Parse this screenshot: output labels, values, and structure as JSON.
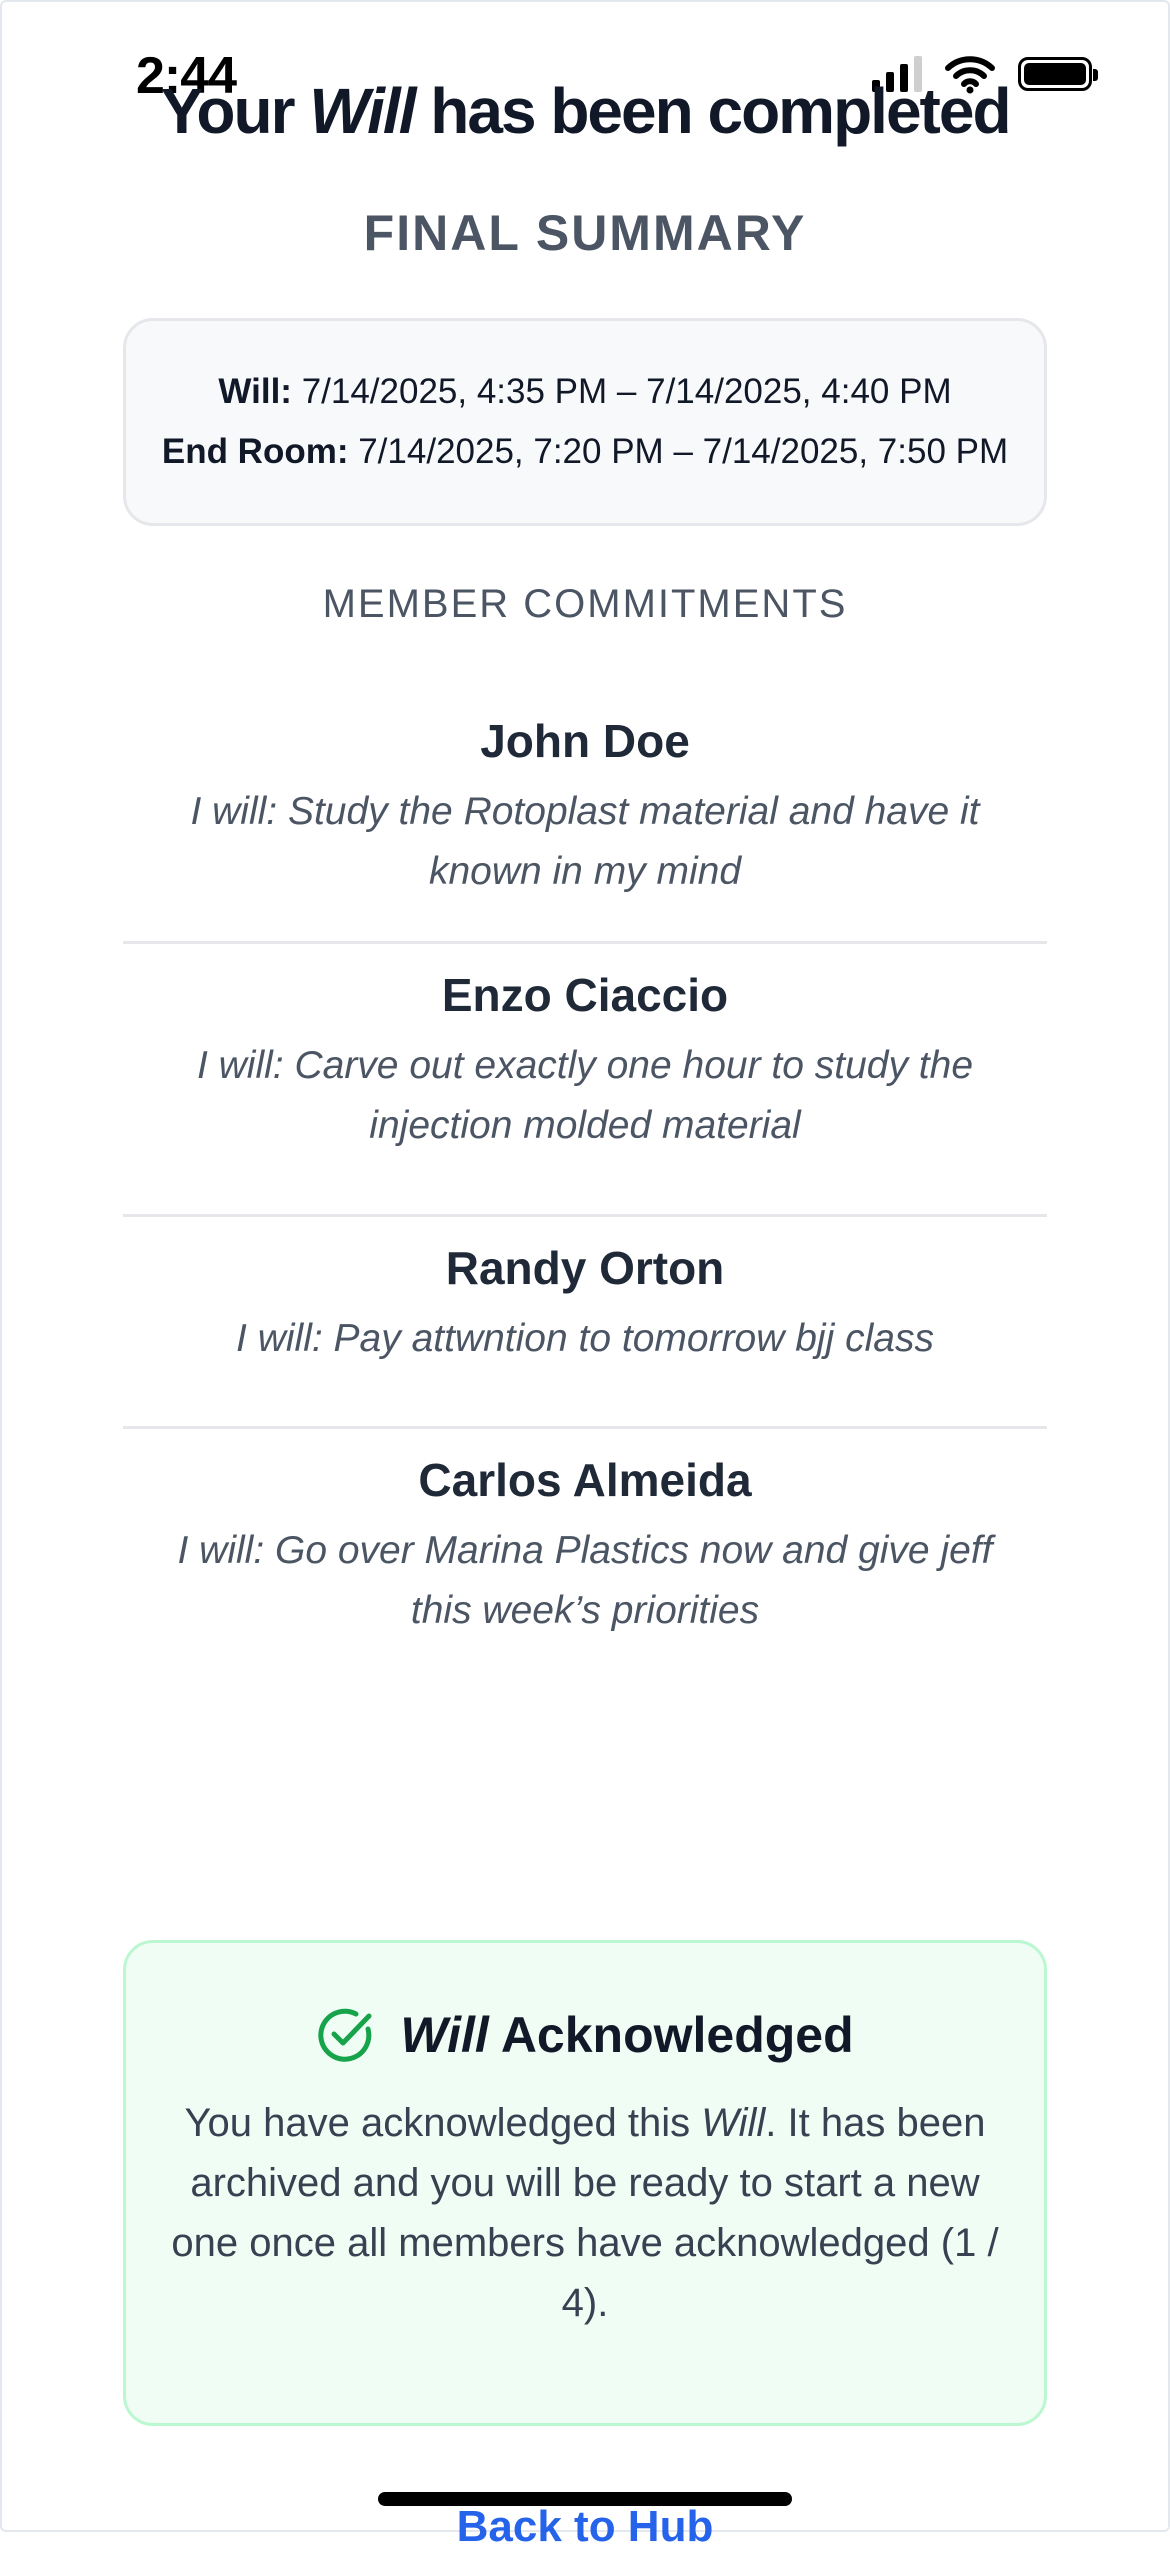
{
  "status_bar": {
    "time": "2:44"
  },
  "header": {
    "title_prefix": "Your ",
    "title_emphasis": "Will",
    "title_suffix": " has been completed",
    "subtitle": "FINAL SUMMARY"
  },
  "summary": {
    "will_label": "Will:",
    "will_range": "7/14/2025, 4:35 PM – 7/14/2025, 4:40 PM",
    "end_room_label": "End Room:",
    "end_room_range": "7/14/2025, 7:20 PM – 7/14/2025, 7:50 PM"
  },
  "members_section": {
    "label": "MEMBER COMMITMENTS",
    "members": [
      {
        "name": "John Doe",
        "commitment": "I will: Study the Rotoplast material and have it known in my mind"
      },
      {
        "name": "Enzo Ciaccio",
        "commitment": "I will: Carve out exactly one hour to study the injection molded material"
      },
      {
        "name": "Randy Orton",
        "commitment": "I will: Pay attwntion to tomorrow bjj class"
      },
      {
        "name": "Carlos Almeida",
        "commitment": "I will: Go over Marina Plastics now and give jeff this week’s priorities"
      }
    ]
  },
  "acknowledged": {
    "icon": "check-circle-icon",
    "title_emphasis": "Will",
    "title_suffix": " Acknowledged",
    "body_prefix": "You have acknowledged this ",
    "body_emphasis": "Will",
    "body_suffix": ". It has been archived and you will be ready to start a new one once all members have acknowledged (1 / 4)."
  },
  "footer": {
    "link_label": "Back to Hub"
  },
  "colors": {
    "ack_bg": "#effdf4",
    "ack_border": "#bbf7d0",
    "ack_icon": "#16a34a",
    "link": "#2563eb"
  }
}
